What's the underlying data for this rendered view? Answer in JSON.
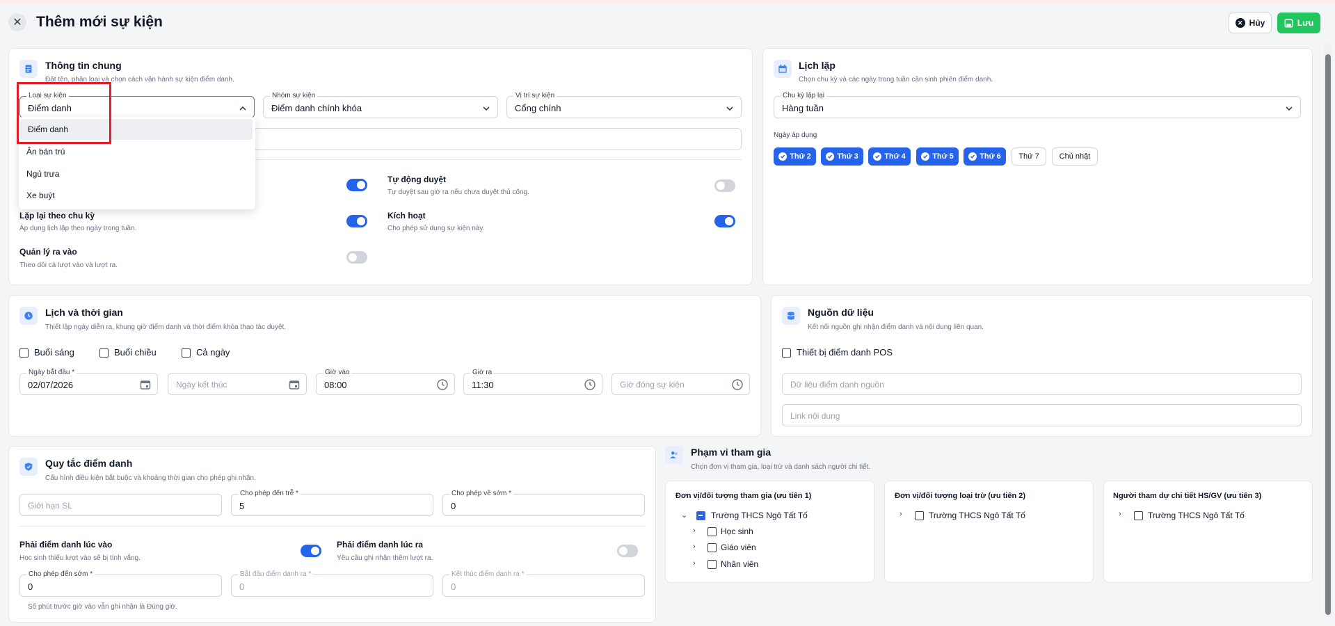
{
  "header": {
    "title": "Thêm mới sự kiện",
    "cancel_label": "Hủy",
    "save_label": "Lưu"
  },
  "general": {
    "title": "Thông tin chung",
    "subtitle": "Đặt tên, phân loại và chọn cách vận hành sự kiện điểm danh.",
    "event_type": {
      "label": "Loại sự kiện",
      "value": "Điểm danh"
    },
    "event_group": {
      "label": "Nhóm sự kiện",
      "value": "Điểm danh chính khóa"
    },
    "event_location": {
      "label": "Vị trí sự kiện",
      "value": "Cổng chính"
    },
    "dropdown_options": [
      "Điểm danh",
      "Ăn bán trú",
      "Ngủ trưa",
      "Xe buýt"
    ],
    "toggles": {
      "auto_approve": {
        "label": "Tự động duyệt",
        "sub": "Tự duyệt sau giờ ra nếu chưa duyệt thủ công.",
        "on": false
      },
      "repeat": {
        "label": "Lặp lại theo chu kỳ",
        "sub": "Áp dụng lịch lặp theo ngày trong tuần.",
        "on": true
      },
      "activate": {
        "label": "Kích hoạt",
        "sub": "Cho phép sử dụng sự kiện này.",
        "on": true
      },
      "in_out": {
        "label": "Quản lý ra vào",
        "sub": "Theo dõi cả lượt vào và lượt ra.",
        "on": false
      },
      "hidden_top": {
        "on": true
      }
    }
  },
  "repeat_schedule": {
    "title": "Lịch lặp",
    "subtitle": "Chọn chu kỳ và các ngày trong tuần cần sinh phiên điểm danh.",
    "cycle": {
      "label": "Chu kỳ lặp lại",
      "value": "Hàng tuần"
    },
    "days_label": "Ngày áp dụng",
    "days": [
      {
        "label": "Thứ 2",
        "on": true
      },
      {
        "label": "Thứ 3",
        "on": true
      },
      {
        "label": "Thứ 4",
        "on": true
      },
      {
        "label": "Thứ 5",
        "on": true
      },
      {
        "label": "Thứ 6",
        "on": true
      },
      {
        "label": "Thứ 7",
        "on": false
      },
      {
        "label": "Chủ nhật",
        "on": false
      }
    ]
  },
  "schedule": {
    "title": "Lịch và thời gian",
    "subtitle": "Thiết lập ngày diễn ra, khung giờ điểm danh và thời điểm khóa thao tác duyệt.",
    "sessions": [
      "Buổi sáng",
      "Buổi chiều",
      "Cả ngày"
    ],
    "start_date": {
      "label": "Ngày bắt đầu *",
      "value": "02/07/2026"
    },
    "end_date": {
      "placeholder": "Ngày kết thúc"
    },
    "time_in": {
      "label": "Giờ vào",
      "value": "08:00"
    },
    "time_out": {
      "label": "Giờ ra",
      "value": "11:30"
    },
    "close_time": {
      "placeholder": "Giờ đóng sự kiện"
    }
  },
  "data_source": {
    "title": "Nguồn dữ liệu",
    "subtitle": "Kết nối nguồn ghi nhận điểm danh và nội dung liên quan.",
    "pos_label": "Thiết bị điểm danh POS",
    "source_placeholder": "Dữ liệu điểm danh nguồn",
    "link_placeholder": "Link nội dung"
  },
  "rules": {
    "title": "Quy tắc điểm danh",
    "subtitle": "Cấu hình điều kiện bắt buộc và khoảng thời gian cho phép ghi nhận.",
    "limit": {
      "placeholder": "Giới hạn SL"
    },
    "late": {
      "label": "Cho phép đến trễ *",
      "value": "5"
    },
    "early_leave": {
      "label": "Cho phép về sớm *",
      "value": "0"
    },
    "must_in": {
      "label": "Phải điểm danh lúc vào",
      "sub": "Học sinh thiếu lượt vào sẽ bị tính vắng.",
      "on": true
    },
    "must_out": {
      "label": "Phải điểm danh lúc ra",
      "sub": "Yêu cầu ghi nhận thêm lượt ra.",
      "on": false
    },
    "early_arrive": {
      "label": "Cho phép đến sớm *",
      "value": "0"
    },
    "out_start": {
      "label": "Bắt đầu điểm danh ra *",
      "value": "0"
    },
    "out_end": {
      "label": "Kết thúc điểm danh ra *",
      "value": "0"
    },
    "note": "Số phút trước giờ vào vẫn ghi nhận là Đúng giờ."
  },
  "scope": {
    "title": "Phạm vi tham gia",
    "subtitle": "Chọn đơn vị tham gia, loại trừ và danh sách người chi tiết.",
    "col1": {
      "title": "Đơn vị/đối tượng tham gia (ưu tiên 1)",
      "root": "Trường THCS Ngô Tất Tố",
      "children": [
        "Học sinh",
        "Giáo viên",
        "Nhân viên"
      ]
    },
    "col2": {
      "title": "Đơn vị/đối tượng loại trừ (ưu tiên 2)",
      "root": "Trường THCS Ngô Tất Tố"
    },
    "col3": {
      "title": "Người tham dự chi tiết HS/GV (ưu tiên 3)",
      "root": "Trường THCS Ngô Tất Tố"
    }
  },
  "colors": {
    "accent": "#2563eb",
    "save": "#22c55e",
    "highlight": "#e11d2a"
  }
}
